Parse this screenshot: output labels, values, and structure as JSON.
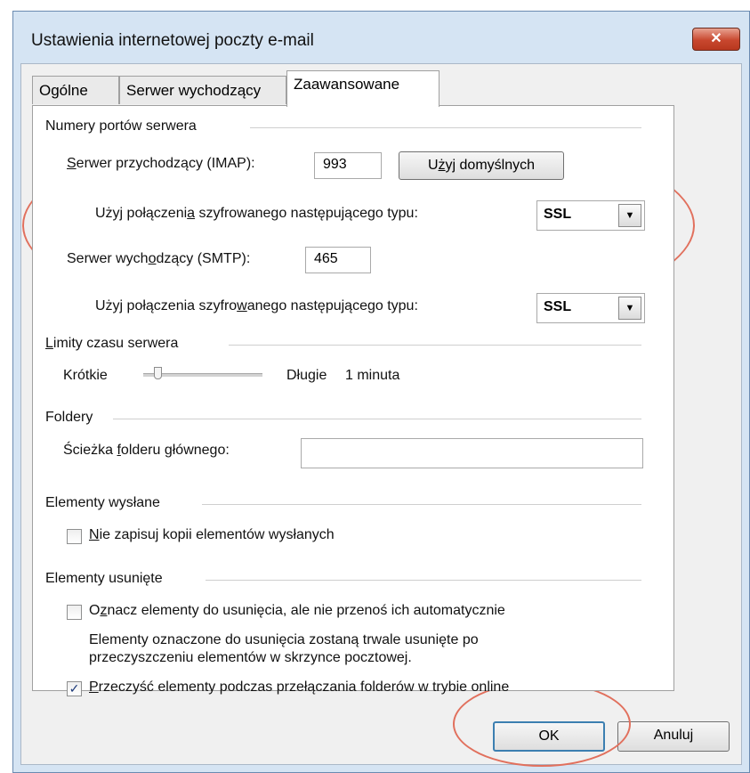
{
  "window": {
    "title": "Ustawienia internetowej poczty e-mail",
    "close_label": "✕"
  },
  "tabs": [
    {
      "label": "Ogólne",
      "active": false
    },
    {
      "label": "Serwer wychodzący",
      "active": false
    },
    {
      "label": "Zaawansowane",
      "active": true
    }
  ],
  "ports": {
    "group_label": "Numery portów serwera",
    "incoming_label_pre": "",
    "incoming_label_u": "S",
    "incoming_label_post": "erwer przychodzący (IMAP):",
    "incoming_value": "993",
    "default_button_pre": "U",
    "default_button_u": "ż",
    "default_button_post": "yj domyślnych",
    "incoming_enc_pre": "Użyj połączeni",
    "incoming_enc_u": "a",
    "incoming_enc_post": " szyfrowanego następującego typu:",
    "incoming_enc_value": "SSL",
    "outgoing_label_pre": "Serwer wych",
    "outgoing_label_u": "o",
    "outgoing_label_post": "dzący (SMTP):",
    "outgoing_value": "465",
    "outgoing_enc_pre": "Użyj połączenia szyfro",
    "outgoing_enc_u": "w",
    "outgoing_enc_post": "anego następującego typu:",
    "outgoing_enc_value": "SSL"
  },
  "timeout": {
    "group_label_u": "L",
    "group_label_post": "imity czasu serwera",
    "short_label": "Krótkie",
    "long_label": "Długie",
    "value": "1 minuta",
    "slider_level": 0.1
  },
  "folders": {
    "group_label": "Foldery",
    "root_label_pre": "Ścieżka ",
    "root_label_u": "f",
    "root_label_post": "olderu głównego:",
    "root_value": ""
  },
  "sent": {
    "group_label": "Elementy wysłane",
    "checkbox_u": "N",
    "checkbox_post": "ie zapisuj kopii elementów wysłanych",
    "checked": false
  },
  "deleted": {
    "group_label": "Elementy usunięte",
    "mark_pre": "O",
    "mark_u": "z",
    "mark_post": "nacz elementy do usunięcia, ale nie przenoś ich automatycznie",
    "mark_checked": false,
    "note_line1": "Elementy oznaczone do usunięcia zostaną trwale usunięte po",
    "note_line2": "przeczyszczeniu elementów w skrzynce pocztowej.",
    "purge_u": "P",
    "purge_post": "rzeczyść elementy podczas przełączania folderów w trybie online",
    "purge_checked": true,
    "check_glyph": "✓"
  },
  "buttons": {
    "ok": "OK",
    "cancel": "Anuluj"
  },
  "annotation_color": "#e1705d"
}
